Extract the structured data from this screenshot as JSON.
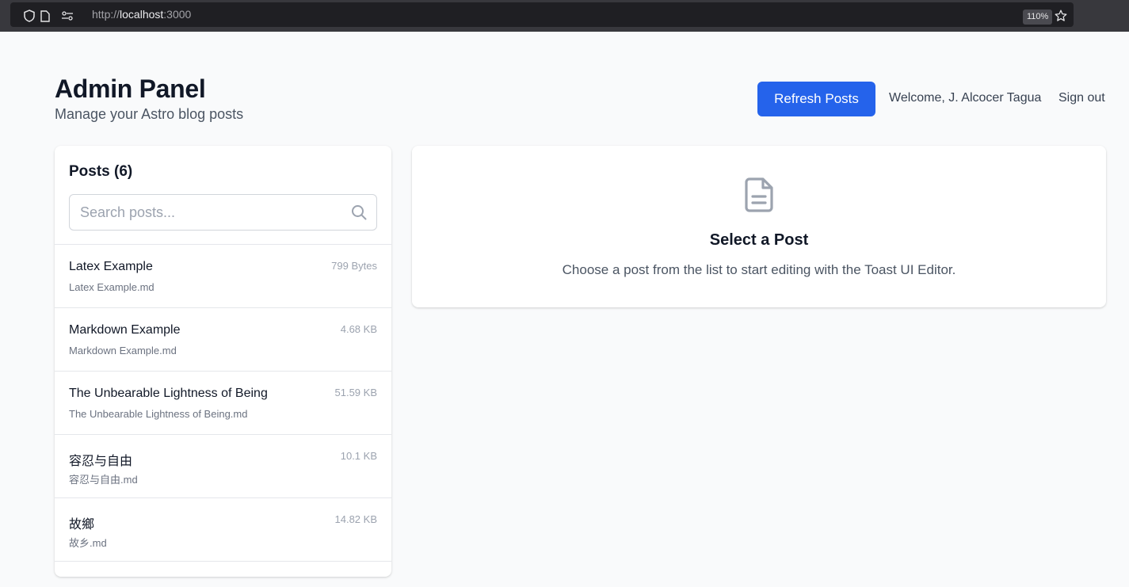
{
  "browser": {
    "url_scheme": "http://",
    "url_host": "localhost",
    "url_port": ":3000",
    "zoom": "110%"
  },
  "header": {
    "title": "Admin Panel",
    "subtitle": "Manage your Astro blog posts",
    "refresh_label": "Refresh Posts",
    "welcome": "Welcome, J. Alcocer Tagua",
    "signout": "Sign out"
  },
  "sidebar": {
    "heading": "Posts (6)",
    "search_placeholder": "Search posts...",
    "posts": [
      {
        "title": "Latex Example",
        "file": "Latex Example.md",
        "size": "799 Bytes"
      },
      {
        "title": "Markdown Example",
        "file": "Markdown Example.md",
        "size": "4.68 KB"
      },
      {
        "title": "The Unbearable Lightness of Being",
        "file": "The Unbearable Lightness of Being.md",
        "size": "51.59 KB"
      },
      {
        "title": "容忍与自由",
        "file": "容忍与自由.md",
        "size": "10.1 KB"
      },
      {
        "title": "故鄉",
        "file": "故乡.md",
        "size": "14.82 KB"
      }
    ]
  },
  "main": {
    "empty_title": "Select a Post",
    "empty_desc": "Choose a post from the list to start editing with the Toast UI Editor."
  },
  "colors": {
    "accent": "#2563eb",
    "background": "#f9fafb",
    "panel": "#ffffff"
  }
}
